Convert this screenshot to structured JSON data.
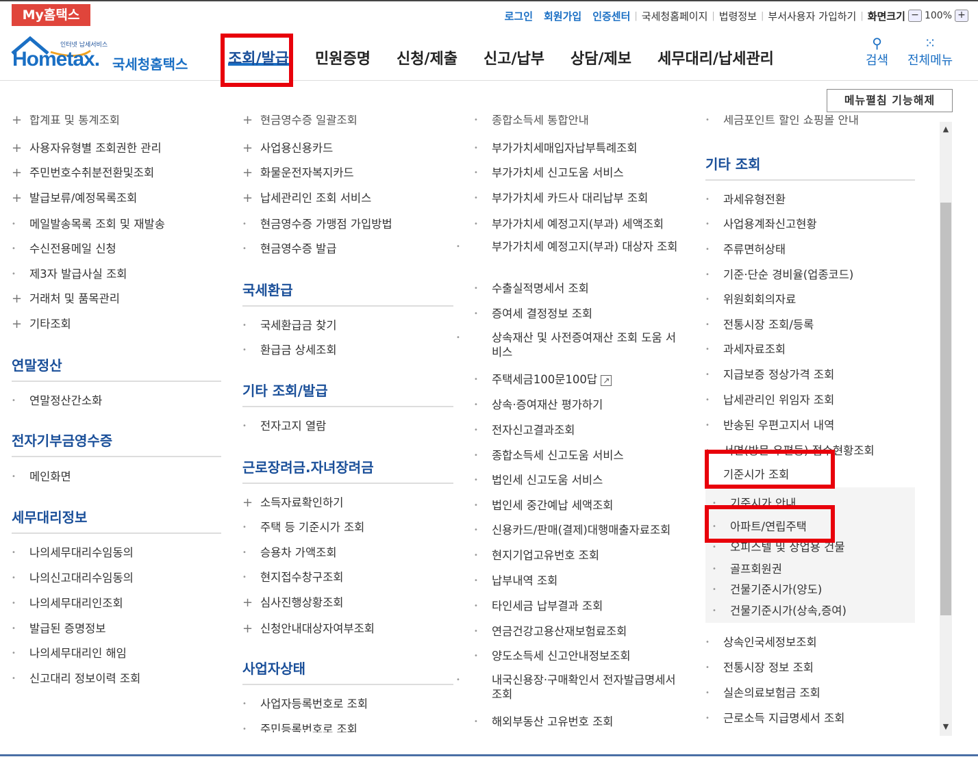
{
  "topbar": {
    "my_hometax": "My홈택스",
    "links_blue": [
      "로그인",
      "회원가입",
      "인증센터"
    ],
    "links_gray": [
      "국세청홈페이지",
      "법령정보",
      "부서사용자 가입하기"
    ],
    "screen_size_label": "화면크기",
    "zoom_minus": "−",
    "zoom_value": "100%",
    "zoom_plus": "+"
  },
  "header": {
    "logo_small": "인터넷 납세서비스",
    "logo_en": "Hometax.",
    "logo_ko": "국세청홈택스",
    "nav": [
      "조회/발급",
      "민원증명",
      "신청/제출",
      "신고/납부",
      "상담/제보",
      "세무대리/납세관리"
    ],
    "search_label": "검색",
    "allmenu_label": "전체메뉴"
  },
  "edit_button": "메뉴펼침 기능해제",
  "col1": {
    "top_cut": "합계표 및 통계조회",
    "items": [
      {
        "mk": "+",
        "text": "사용자유형별 조회권한 관리"
      },
      {
        "mk": "+",
        "text": "주민번호수취분전환및조회"
      },
      {
        "mk": "+",
        "text": "발급보류/예정목록조회"
      },
      {
        "mk": "•",
        "text": "메일발송목록 조회 및 재발송"
      },
      {
        "mk": "•",
        "text": "수신전용메일 신청"
      },
      {
        "mk": "•",
        "text": "제3자 발급사실 조회"
      },
      {
        "mk": "+",
        "text": "거래처 및 품목관리"
      },
      {
        "mk": "+",
        "text": "기타조회"
      }
    ],
    "sec_yearend": "연말정산",
    "yearend_items": [
      "연말정산간소화"
    ],
    "sec_donation": "전자기부금영수증",
    "donation_items": [
      "메인화면"
    ],
    "sec_agent": "세무대리정보",
    "agent_items": [
      "나의세무대리수임동의",
      "나의신고대리수임동의",
      "나의세무대리인조회",
      "발급된 증명정보",
      "나의세무대리인 해임",
      "신고대리 정보이력 조회"
    ]
  },
  "col2": {
    "top_cut": "현금영수증 일괄조회",
    "items": [
      {
        "mk": "+",
        "text": "사업용신용카드"
      },
      {
        "mk": "+",
        "text": "화물운전자복지카드"
      },
      {
        "mk": "+",
        "text": "납세관리인 조회 서비스"
      },
      {
        "mk": "•",
        "text": "현금영수증 가맹점 가입방법"
      },
      {
        "mk": "•",
        "text": "현금영수증 발급"
      }
    ],
    "sec_refund": "국세환급",
    "refund_items": [
      "국세환급금 찾기",
      "환급금 상세조회"
    ],
    "sec_other": "기타 조회/발급",
    "other_items": [
      "전자고지 열람"
    ],
    "sec_earned": "근로장려금.자녀장려금",
    "earned_items": [
      {
        "mk": "+",
        "text": "소득자료확인하기"
      },
      {
        "mk": "•",
        "text": "주택 등 기준시가 조회"
      },
      {
        "mk": "•",
        "text": "승용차 가액조회"
      },
      {
        "mk": "•",
        "text": "현지접수창구조회"
      },
      {
        "mk": "+",
        "text": "심사진행상황조회"
      },
      {
        "mk": "+",
        "text": "신청안내대상자여부조회"
      }
    ],
    "sec_biz": "사업자상태",
    "biz_items": [
      "사업자등록번호로 조회",
      "주민등록번호로 조회"
    ]
  },
  "col3": {
    "top_cut": "종합소득세 통합안내",
    "items": [
      "부가가치세매입자납부특례조회",
      "부가가치세 신고도움 서비스",
      "부가가치세 카드사 대리납부 조회",
      "부가가치세 예정고지(부과) 세액조회",
      "부가가치세 예정고지(부과) 대상자 조회",
      "수출실적명세서 조회",
      "증여세 결정정보 조회",
      "상속재산 및 사전증여재산 조회 도움 서비스",
      "주택세금100문100답",
      "상속·증여재산 평가하기",
      "전자신고결과조회",
      "종합소득세 신고도움 서비스",
      "법인세 신고도움 서비스",
      "법인세 중간예납 세액조회",
      "신용카드/판매(결제)대행매출자료조회",
      "현지기업고유번호 조회",
      "납부내역 조회",
      "타인세금 납부결과 조회",
      "연금건강고용산재보험료조회",
      "양도소득세 신고안내정보조회",
      "내국신용장·구매확인서 전자발급명세서 조회",
      "해외부동산 고유번호 조회"
    ],
    "external_icon": "↗"
  },
  "col4": {
    "top_cut": "세금포인트 할인 쇼핑몰 안내",
    "sec_other": "기타 조회",
    "items": [
      "과세유형전환",
      "사업용계좌신고현황",
      "주류면허상태",
      "기준·단순 경비율(업종코드)",
      "위원회회의자료",
      "전통시장 조회/등록",
      "과세자료조회",
      "지급보증 정상가격 조회",
      "납세관리인 위임자 조회",
      "반송된 우편고지서 내역",
      "서면(방문·우편등) 접수현황조회",
      "기준시가 조회"
    ],
    "sub_items": [
      "기준시가 안내",
      "아파트/연립주택",
      "오피스텔 및 상업용 건물",
      "골프회원권",
      "건물기준시가(양도)",
      "건물기준시가(상속,증여)"
    ],
    "items_after": [
      "상속인국세정보조회",
      "전통시장 정보 조회",
      "실손의료보험금 조회",
      "근로소득 지급명세서 조회"
    ]
  },
  "colors": {
    "accent": "#1a6fc4",
    "highlight": "#e8000b",
    "brand_red": "#e0453b"
  }
}
